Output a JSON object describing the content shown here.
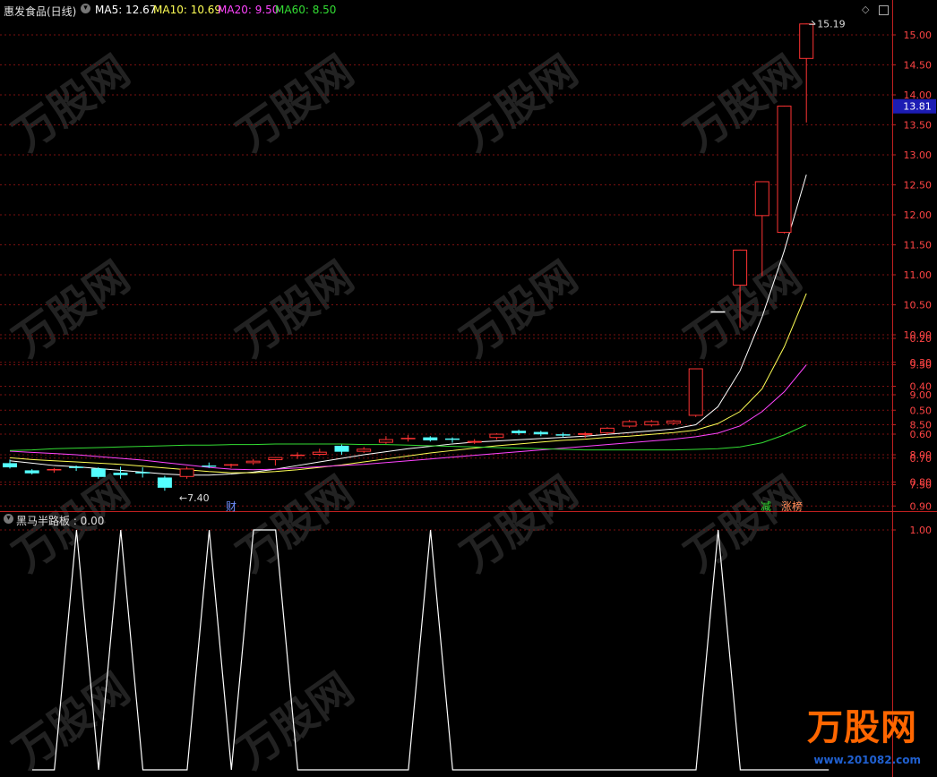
{
  "main_header": {
    "title": "惠发食品(日线)",
    "ma5_label": "MA5: 12.67",
    "ma10_label": "MA10: 10.69",
    "ma20_label": "MA20: 9.50",
    "ma60_label": "MA60: 8.50"
  },
  "sub_header": {
    "title": "黑马半路板 : 0.00"
  },
  "markers": {
    "cai": "财",
    "jian": "减",
    "zhangbang": "涨榜"
  },
  "watermark": {
    "brand": "万股网",
    "url": "www.201082.com"
  },
  "colors": {
    "up": "#ff3333",
    "down": "#54ffff",
    "ma5": "#ffffff",
    "ma10": "#ffff55",
    "ma20": "#ff44ff",
    "ma60": "#33dd33",
    "grid": "#7a1010",
    "axis": "#c02020",
    "price_tag_bg": "#1c1cb4"
  },
  "chart_data": [
    {
      "type": "candlestick",
      "title": "惠发食品(日线)",
      "ylim": [
        7.2,
        15.4
      ],
      "y_ticks": [
        7.5,
        8.0,
        8.5,
        9.0,
        9.5,
        10.0,
        10.5,
        11.0,
        11.5,
        12.0,
        12.5,
        13.0,
        13.5,
        14.0,
        14.5,
        15.0
      ],
      "y_tick_labels": [
        "7.50",
        "8.00",
        "8.50",
        "9.00",
        "9.50",
        "10.00",
        "10.50",
        "11.00",
        "11.50",
        "12.00",
        "12.50",
        "13.00",
        "13.50",
        "14.00",
        "14.50",
        "15.00"
      ],
      "current_price": 13.81,
      "current_price_label": "13.81",
      "high_annotation": {
        "index": 36,
        "value": 15.19,
        "label": "15.19"
      },
      "low_annotation": {
        "index": 7,
        "value": 7.4,
        "label": "7.40"
      },
      "candles": [
        {
          "o": 7.86,
          "h": 7.92,
          "l": 7.77,
          "c": 7.79
        },
        {
          "o": 7.74,
          "h": 7.76,
          "l": 7.67,
          "c": 7.69
        },
        {
          "o": 7.73,
          "h": 7.78,
          "l": 7.7,
          "c": 7.75
        },
        {
          "o": 7.79,
          "h": 7.82,
          "l": 7.73,
          "c": 7.78
        },
        {
          "o": 7.77,
          "h": 7.79,
          "l": 7.6,
          "c": 7.63
        },
        {
          "o": 7.7,
          "h": 7.8,
          "l": 7.6,
          "c": 7.66
        },
        {
          "o": 7.7,
          "h": 7.79,
          "l": 7.62,
          "c": 7.69
        },
        {
          "o": 7.62,
          "h": 7.65,
          "l": 7.4,
          "c": 7.45
        },
        {
          "o": 7.63,
          "h": 7.8,
          "l": 7.6,
          "c": 7.77
        },
        {
          "o": 7.82,
          "h": 7.87,
          "l": 7.78,
          "c": 7.8
        },
        {
          "o": 7.83,
          "h": 7.85,
          "l": 7.78,
          "c": 7.83
        },
        {
          "o": 7.86,
          "h": 7.93,
          "l": 7.83,
          "c": 7.9
        },
        {
          "o": 7.91,
          "h": 7.96,
          "l": 7.82,
          "c": 7.96
        },
        {
          "o": 7.99,
          "h": 8.04,
          "l": 7.93,
          "c": 7.99
        },
        {
          "o": 8.0,
          "h": 8.1,
          "l": 7.98,
          "c": 8.05
        },
        {
          "o": 8.15,
          "h": 8.17,
          "l": 8.0,
          "c": 8.05
        },
        {
          "o": 8.05,
          "h": 8.13,
          "l": 8.03,
          "c": 8.1
        },
        {
          "o": 8.2,
          "h": 8.31,
          "l": 8.18,
          "c": 8.26
        },
        {
          "o": 8.27,
          "h": 8.33,
          "l": 8.22,
          "c": 8.27
        },
        {
          "o": 8.29,
          "h": 8.31,
          "l": 8.22,
          "c": 8.24
        },
        {
          "o": 8.26,
          "h": 8.29,
          "l": 8.2,
          "c": 8.24
        },
        {
          "o": 8.2,
          "h": 8.26,
          "l": 8.18,
          "c": 8.23
        },
        {
          "o": 8.28,
          "h": 8.36,
          "l": 8.25,
          "c": 8.35
        },
        {
          "o": 8.4,
          "h": 8.42,
          "l": 8.33,
          "c": 8.36
        },
        {
          "o": 8.38,
          "h": 8.4,
          "l": 8.31,
          "c": 8.34
        },
        {
          "o": 8.33,
          "h": 8.37,
          "l": 8.29,
          "c": 8.31
        },
        {
          "o": 8.33,
          "h": 8.38,
          "l": 8.28,
          "c": 8.36
        },
        {
          "o": 8.36,
          "h": 8.46,
          "l": 8.33,
          "c": 8.45
        },
        {
          "o": 8.47,
          "h": 8.58,
          "l": 8.45,
          "c": 8.56
        },
        {
          "o": 8.49,
          "h": 8.58,
          "l": 8.47,
          "c": 8.56
        },
        {
          "o": 8.52,
          "h": 8.58,
          "l": 8.5,
          "c": 8.57
        },
        {
          "o": 8.65,
          "h": 9.44,
          "l": 8.63,
          "c": 9.44
        },
        {
          "o": 10.38,
          "h": 10.38,
          "l": 10.38,
          "c": 10.38
        },
        {
          "o": 10.82,
          "h": 11.42,
          "l": 10.12,
          "c": 11.42
        },
        {
          "o": 11.98,
          "h": 12.56,
          "l": 10.98,
          "c": 12.56
        },
        {
          "o": 11.7,
          "h": 13.82,
          "l": 11.69,
          "c": 13.82
        },
        {
          "o": 14.6,
          "h": 15.19,
          "l": 13.54,
          "c": 15.19
        }
      ],
      "series": [
        {
          "name": "MA5",
          "values": [
            7.9,
            7.86,
            7.82,
            7.8,
            7.77,
            7.74,
            7.71,
            7.68,
            7.66,
            7.66,
            7.68,
            7.71,
            7.76,
            7.82,
            7.88,
            7.94,
            8.0,
            8.05,
            8.1,
            8.14,
            8.18,
            8.21,
            8.23,
            8.25,
            8.27,
            8.29,
            8.31,
            8.34,
            8.37,
            8.4,
            8.43,
            8.5,
            8.8,
            9.4,
            10.3,
            11.4,
            12.67
          ]
        },
        {
          "name": "MA10",
          "values": [
            7.95,
            7.92,
            7.9,
            7.88,
            7.86,
            7.84,
            7.81,
            7.78,
            7.75,
            7.72,
            7.7,
            7.7,
            7.72,
            7.75,
            7.79,
            7.83,
            7.88,
            7.93,
            7.98,
            8.03,
            8.07,
            8.11,
            8.15,
            8.18,
            8.21,
            8.24,
            8.26,
            8.29,
            8.31,
            8.34,
            8.37,
            8.41,
            8.52,
            8.72,
            9.1,
            9.8,
            10.69
          ]
        },
        {
          "name": "MA20",
          "values": [
            8.06,
            8.04,
            8.02,
            8.0,
            7.97,
            7.94,
            7.91,
            7.87,
            7.83,
            7.79,
            7.76,
            7.75,
            7.76,
            7.78,
            7.8,
            7.82,
            7.84,
            7.87,
            7.9,
            7.93,
            7.96,
            7.99,
            8.02,
            8.05,
            8.08,
            8.11,
            8.14,
            8.17,
            8.2,
            8.23,
            8.26,
            8.3,
            8.36,
            8.48,
            8.72,
            9.05,
            9.5
          ]
        },
        {
          "name": "MA60",
          "values": [
            8.07,
            8.08,
            8.1,
            8.11,
            8.12,
            8.13,
            8.14,
            8.15,
            8.16,
            8.16,
            8.17,
            8.17,
            8.18,
            8.18,
            8.18,
            8.18,
            8.17,
            8.17,
            8.16,
            8.15,
            8.14,
            8.13,
            8.12,
            8.11,
            8.1,
            8.09,
            8.08,
            8.08,
            8.08,
            8.08,
            8.08,
            8.09,
            8.1,
            8.13,
            8.2,
            8.33,
            8.5
          ]
        }
      ]
    },
    {
      "type": "line",
      "title": "黑马半路板 : 0.00",
      "ylim": [
        0,
        1.05
      ],
      "y_ticks": [
        0.2,
        0.3,
        0.4,
        0.5,
        0.6,
        0.7,
        0.8,
        0.9,
        1.0
      ],
      "y_tick_labels": [
        "0.20",
        "0.30",
        "0.40",
        "0.50",
        "0.60",
        "0.70",
        "0.80",
        "0.90",
        "1.00"
      ],
      "series": [
        {
          "name": "黑马半路板",
          "values": [
            0,
            0,
            1,
            0,
            1,
            0,
            0,
            0,
            1,
            0,
            1,
            1,
            0,
            0,
            0,
            0,
            0,
            0,
            1,
            0,
            0,
            0,
            0,
            0,
            0,
            0,
            0,
            0,
            0,
            0,
            0,
            1,
            0,
            0,
            0,
            0,
            0
          ]
        }
      ]
    }
  ]
}
